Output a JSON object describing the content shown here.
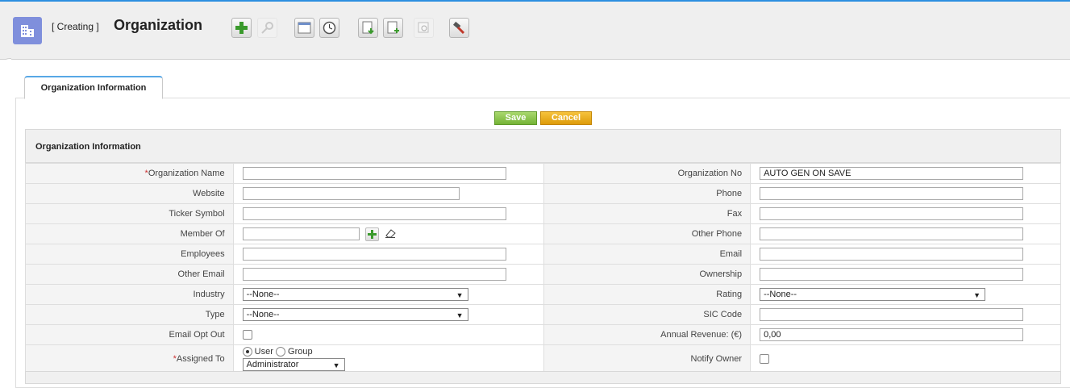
{
  "header": {
    "mode_label": "[ Creating ]",
    "title": "Organization",
    "module_icon": "organization-building-icon",
    "toolbar": [
      {
        "name": "add-icon",
        "enabled": true
      },
      {
        "name": "search-icon",
        "enabled": false
      },
      {
        "name": "calendar-icon",
        "enabled": true
      },
      {
        "name": "clock-icon",
        "enabled": true
      },
      {
        "name": "import-icon",
        "enabled": true
      },
      {
        "name": "export-icon",
        "enabled": true
      },
      {
        "name": "find-duplicates-icon",
        "enabled": false
      },
      {
        "name": "settings-hammer-icon",
        "enabled": true
      }
    ]
  },
  "tabs": [
    {
      "label": "Organization Information",
      "active": true
    }
  ],
  "actions": {
    "save": "Save",
    "cancel": "Cancel"
  },
  "colors": {
    "accent": "#2c8fe0",
    "save": "#74b336",
    "cancel": "#dd9b0a",
    "required": "#cc3333"
  },
  "section": {
    "title": "Organization Information"
  },
  "form": {
    "organization_name": {
      "required_mark": "*",
      "label": "Organization Name",
      "value": ""
    },
    "organization_no": {
      "label": "Organization No",
      "value": "AUTO GEN ON SAVE"
    },
    "website": {
      "label": "Website",
      "value": ""
    },
    "phone": {
      "label": "Phone",
      "value": ""
    },
    "ticker_symbol": {
      "label": "Ticker Symbol",
      "value": ""
    },
    "fax": {
      "label": "Fax",
      "value": ""
    },
    "member_of": {
      "label": "Member Of",
      "value": ""
    },
    "other_phone": {
      "label": "Other Phone",
      "value": ""
    },
    "employees": {
      "label": "Employees",
      "value": ""
    },
    "email": {
      "label": "Email",
      "value": ""
    },
    "other_email": {
      "label": "Other Email",
      "value": ""
    },
    "ownership": {
      "label": "Ownership",
      "value": ""
    },
    "industry": {
      "label": "Industry",
      "value": "--None--"
    },
    "rating": {
      "label": "Rating",
      "value": "--None--"
    },
    "type": {
      "label": "Type",
      "value": "--None--"
    },
    "sic_code": {
      "label": "SIC Code",
      "value": ""
    },
    "email_opt_out": {
      "label": "Email Opt Out",
      "checked": false
    },
    "annual_revenue": {
      "label": "Annual Revenue: (€)",
      "value": "0,00"
    },
    "assigned_to": {
      "required_mark": "*",
      "label": "Assigned To",
      "option_user": "User",
      "option_group": "Group",
      "selected_option": "User",
      "value": "Administrator"
    },
    "notify_owner": {
      "label": "Notify Owner",
      "checked": false
    }
  }
}
